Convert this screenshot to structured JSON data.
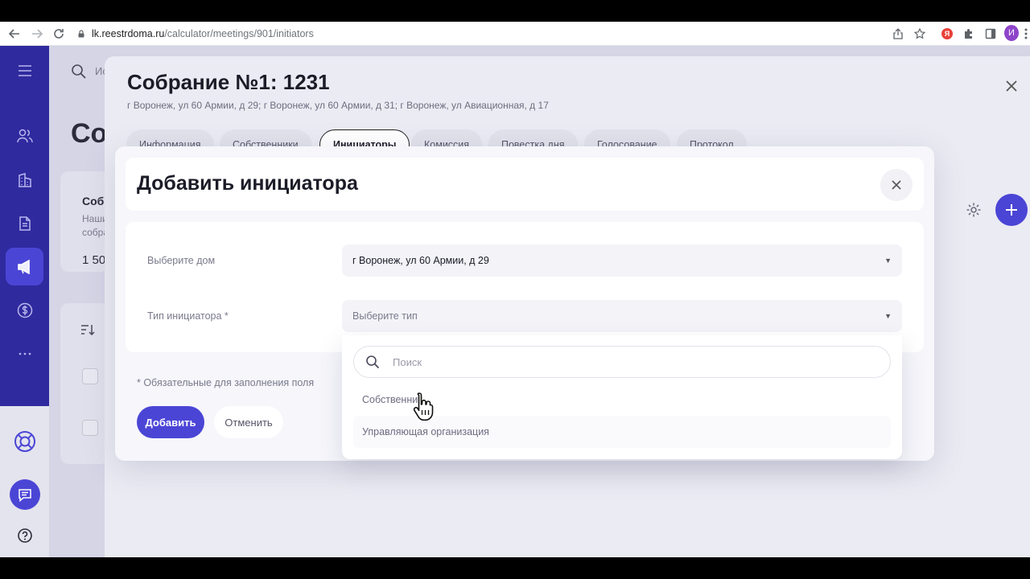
{
  "browser": {
    "url_host": "lk.reestrdoma.ru",
    "url_path": "/calculator/meetings/901/initiators",
    "avatar_letter": "И",
    "yandex_letter": "Я"
  },
  "background": {
    "search_placeholder": "Ис",
    "page_title": "Со",
    "card_title": "Собр",
    "card_line1": "Наши",
    "card_line2": "собра",
    "card_value": "1 50"
  },
  "drawer": {
    "title": "Собрание №1: 1231",
    "address": "г Воронеж, ул 60 Армии, д 29; г Воронеж, ул 60 Армии, д 31; г Воронеж, ул Авиационная, д 17",
    "tabs": [
      {
        "label": "Информация"
      },
      {
        "label": "Собственники"
      },
      {
        "label": "Инициаторы"
      },
      {
        "label": "Комиссия"
      },
      {
        "label": "Повестка дня"
      },
      {
        "label": "Голосование"
      },
      {
        "label": "Протокол"
      }
    ]
  },
  "modal": {
    "title": "Добавить инициатора",
    "house_label": "Выберите дом",
    "house_value": "г Воронеж, ул 60 Армии, д 29",
    "type_label": "Тип инициатора *",
    "type_placeholder": "Выберите тип",
    "required_note": "* Обязательные для заполнения поля",
    "add_label": "Добавить",
    "cancel_label": "Отменить"
  },
  "dropdown": {
    "search_placeholder": "Поиск",
    "options": [
      {
        "label": "Собственник"
      },
      {
        "label": "Управляющая организация"
      }
    ]
  },
  "colors": {
    "accent": "#4b45d6",
    "sidebar": "#2f2a9e"
  }
}
